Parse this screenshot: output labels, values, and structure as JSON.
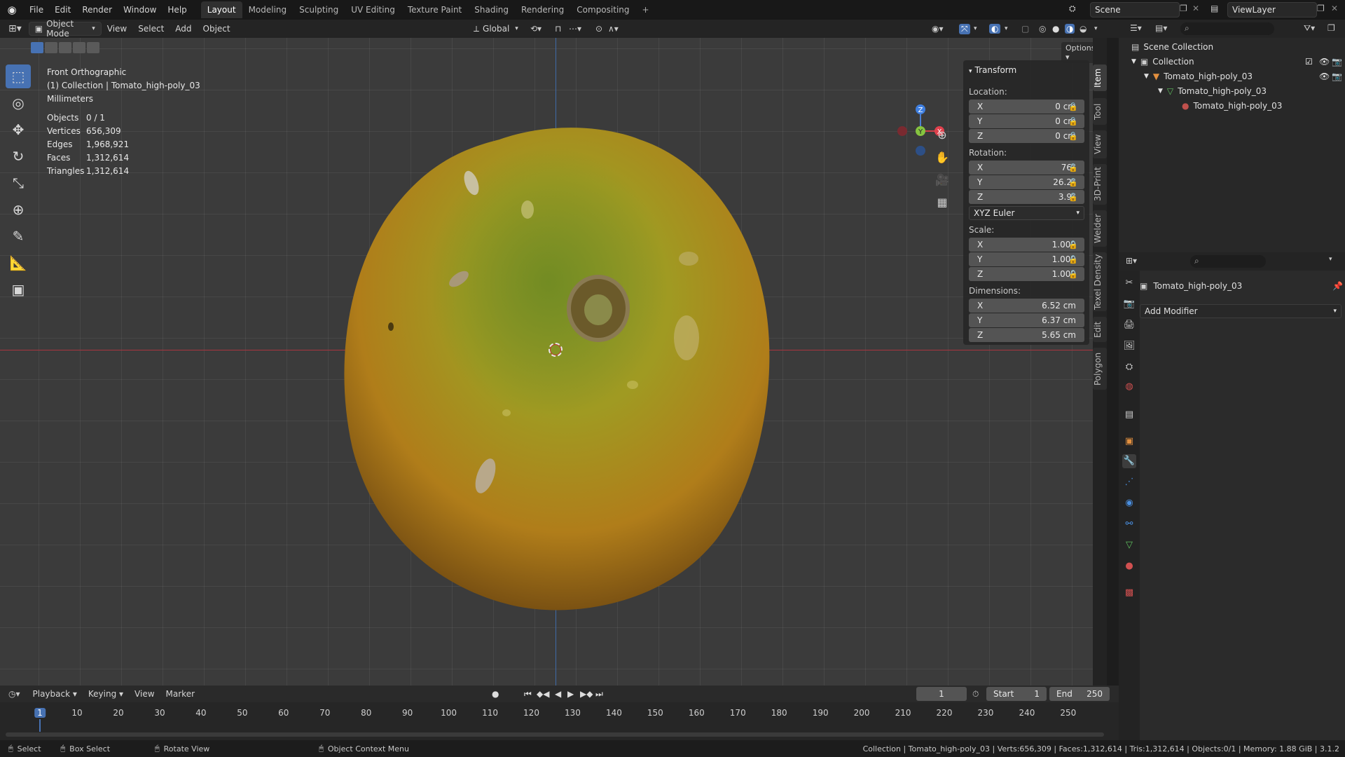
{
  "menu": {
    "items": [
      "File",
      "Edit",
      "Render",
      "Window",
      "Help"
    ]
  },
  "workspaces": [
    "Layout",
    "Modeling",
    "Sculpting",
    "UV Editing",
    "Texture Paint",
    "Shading",
    "Rendering",
    "Compositing"
  ],
  "active_workspace": "Layout",
  "scene": {
    "name": "Scene",
    "view_layer": "ViewLayer"
  },
  "header": {
    "mode": "Object Mode",
    "view": "View",
    "select": "Select",
    "add": "Add",
    "object": "Object",
    "orientation": "Global",
    "options": "Options"
  },
  "viewport": {
    "view_name": "Front Orthographic",
    "collection_line": "(1) Collection | Tomato_high-poly_03",
    "units": "Millimeters",
    "stats": [
      {
        "label": "Objects",
        "value": "0 / 1"
      },
      {
        "label": "Vertices",
        "value": "656,309"
      },
      {
        "label": "Edges",
        "value": "1,968,921"
      },
      {
        "label": "Faces",
        "value": "1,312,614"
      },
      {
        "label": "Triangles",
        "value": "1,312,614"
      }
    ]
  },
  "npanel": {
    "title": "Transform",
    "location_label": "Location:",
    "location": [
      {
        "axis": "X",
        "value": "0 cm"
      },
      {
        "axis": "Y",
        "value": "0 cm"
      },
      {
        "axis": "Z",
        "value": "0 cm"
      }
    ],
    "rotation_label": "Rotation:",
    "rotation": [
      {
        "axis": "X",
        "value": "76°"
      },
      {
        "axis": "Y",
        "value": "26.2°"
      },
      {
        "axis": "Z",
        "value": "3.9°"
      }
    ],
    "rotation_mode": "XYZ Euler",
    "scale_label": "Scale:",
    "scale": [
      {
        "axis": "X",
        "value": "1.000"
      },
      {
        "axis": "Y",
        "value": "1.000"
      },
      {
        "axis": "Z",
        "value": "1.000"
      }
    ],
    "dimensions_label": "Dimensions:",
    "dimensions": [
      {
        "axis": "X",
        "value": "6.52 cm"
      },
      {
        "axis": "Y",
        "value": "6.37 cm"
      },
      {
        "axis": "Z",
        "value": "5.65 cm"
      }
    ],
    "tabs": [
      "Item",
      "Tool",
      "View",
      "3D-Print",
      "Welder",
      "Texel Density",
      "Edit",
      "Polygon"
    ]
  },
  "gizmo": {
    "z": "Z",
    "y": "Y",
    "x": "X"
  },
  "outliner": {
    "root": "Scene Collection",
    "collection": "Collection",
    "object": "Tomato_high-poly_03",
    "mesh": "Tomato_high-poly_03",
    "material": "Tomato_high-poly_03"
  },
  "properties": {
    "object_name": "Tomato_high-poly_03",
    "add_modifier": "Add Modifier"
  },
  "timeline": {
    "menus": [
      "Playback",
      "Keying",
      "View",
      "Marker"
    ],
    "current_frame": "1",
    "start_label": "Start",
    "start": "1",
    "end_label": "End",
    "end": "250",
    "ticks": [
      "1",
      "10",
      "20",
      "30",
      "40",
      "50",
      "60",
      "70",
      "80",
      "90",
      "100",
      "110",
      "120",
      "130",
      "140",
      "150",
      "160",
      "170",
      "180",
      "190",
      "200",
      "210",
      "220",
      "230",
      "240",
      "250"
    ]
  },
  "status": {
    "select": "Select",
    "box_select": "Box Select",
    "rotate_view": "Rotate View",
    "context_menu": "Object Context Menu",
    "info": "Collection | Tomato_high-poly_03 | Verts:656,309 | Faces:1,312,614 | Tris:1,312,614 | Objects:0/1 | Memory: 1.88 GiB | 3.1.2"
  },
  "colors": {
    "accent": "#4772b3",
    "x_axis": "#a8353f",
    "z_axis": "#3f6aa8"
  }
}
